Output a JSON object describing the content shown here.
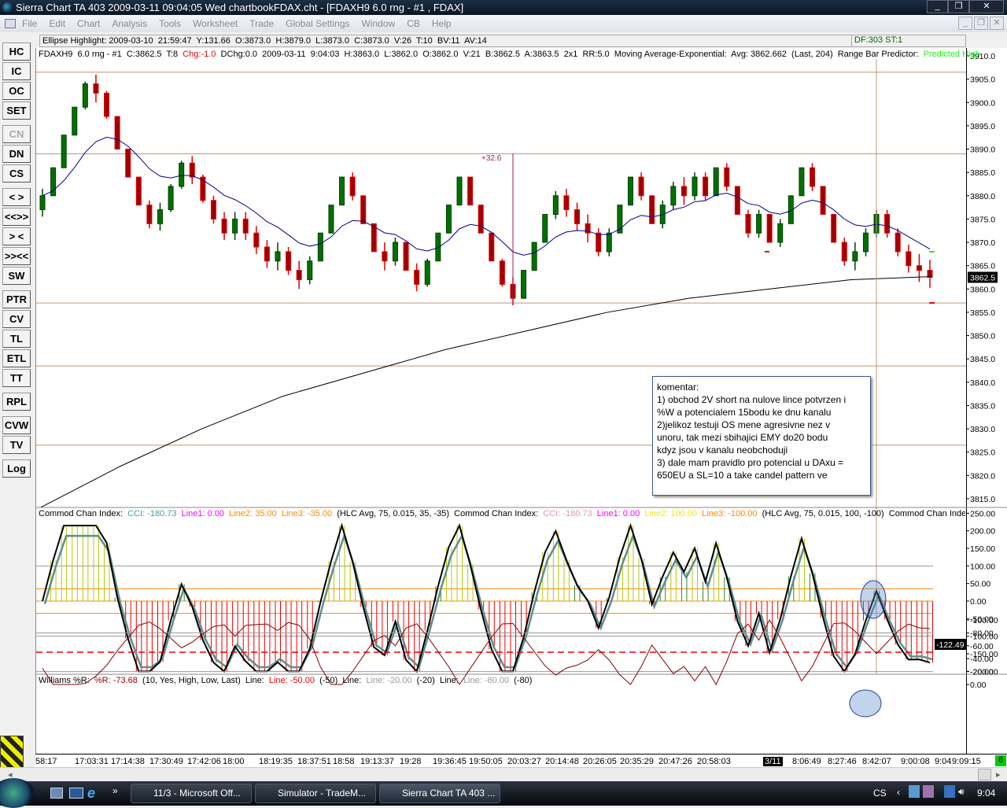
{
  "window": {
    "title": "Sierra Chart TA 403  2009-03-11  09:04:05  Wed   chartbookFDAX.cht - [FDAXH9  6.0 rng - #1 , FDAX]"
  },
  "menu": [
    "File",
    "Edit",
    "Chart",
    "Analysis",
    "Tools",
    "Worksheet",
    "Trade",
    "Global Settings",
    "Window",
    "CB",
    "Help"
  ],
  "toolbar": [
    {
      "l": "HC"
    },
    {
      "l": "IC"
    },
    {
      "l": "OC"
    },
    {
      "l": "SET"
    },
    {
      "l": "CN",
      "disabled": true
    },
    {
      "l": "DN"
    },
    {
      "l": "CS"
    },
    {
      "l": "< >"
    },
    {
      "l": "<<>>"
    },
    {
      "l": "> <"
    },
    {
      "l": ">><<"
    },
    {
      "l": "SW"
    },
    {
      "l": "PTR"
    },
    {
      "l": "CV"
    },
    {
      "l": "TL"
    },
    {
      "l": "ETL"
    },
    {
      "l": "TT"
    },
    {
      "l": "RPL"
    },
    {
      "l": "CVW"
    },
    {
      "l": "TV"
    },
    {
      "l": "Log"
    }
  ],
  "info": {
    "ellipse": "Ellipse Highlight: 2009-03-10  21:59:47  Y:131.66  O:3873.0  H:3879.0  L:3873.0  C:3873.0  V:26  T:10  BV:11  AV:14",
    "df": "DF:303  ST:1"
  },
  "price_header": {
    "main": "FDAXH9  6.0 rng - #1  C:3862.5  T:8  ",
    "chg": "Chg:-1.0",
    "rest": "  DChg:0.0  2009-03-11  9:04:03  H:3863.0  L:3862.0  O:3862.0  V:21  B:3862.5  A:3863.5  2x1  RR:5.0  Moving Average-Exponential:  Avg: 3862.662  (Last, 204)  Range Bar Predictor:  ",
    "pred": "Predicted High"
  },
  "cci_header": {
    "a": "Commod Chan Index:  ",
    "b": "CCI: -180.73  ",
    "c": "Line1: 0.00  ",
    "d": "Line2: 35.00  ",
    "e": "Line3: -35.00  ",
    "f": "(HLC Avg, 75, 0.015, 35, -35)  Commod Chan Index:  ",
    "g": "CCI: -180.73  ",
    "h": "Line1: 0.00  ",
    "i": "Line2: 100.00  ",
    "j": "Line3: -100.00  ",
    "k": "(HLC Avg, 75, 0.015, 100, -100)  Commod Chan Index:  ",
    "l": "CC"
  },
  "wr_header": {
    "a": "Williams %R:  ",
    "b": "%R: -73.68",
    "c": "  (10, Yes, High, Low, Last)  Line:  ",
    "d": "Line: -50.00",
    "e": "  (-50)  Line:  ",
    "f": "Line: -20.00",
    "g": "  (-20)  Line:  ",
    "h": "Line: -80.00",
    "i": "  (-80)"
  },
  "annotation": {
    "label": "+32.6"
  },
  "comment": [
    "komentar:",
    "1) obchod 2V short na nulove lince potvrzen i",
    "%W a potencialem 15bodu ke dnu kanalu",
    "2)jelikoz testuji OS mene agresivne nez v",
    "unoru, tak mezi sbihajici EMY do20 bodu",
    "kdyz jsou v kanalu neobchoduji",
    "3) dale mam pravidlo pro potencial u DAxu =",
    "650EU a SL=10 a take candel pattern ve"
  ],
  "time_labels": [
    "58:17",
    "17:03:31",
    "17:14:38",
    "17:30:49",
    "17:42:06",
    "18:00",
    "18:19:35",
    "18:37:51",
    "18:58",
    "19:13:37",
    "19:28",
    "19:36:45",
    "19:50:05",
    "20:03:27",
    "20:14:48",
    "20:26:05",
    "20:35:29",
    "20:47:26",
    "20:58:03",
    "3/11",
    "8:06:49",
    "8:27:46",
    "8:42:07",
    "9:00:08",
    "9:04",
    "9:09:15"
  ],
  "badge": "6",
  "taskbar": {
    "items": [
      "11/3 - Microsoft Off...",
      "Simulator - TradeM...",
      "Sierra Chart TA 403  ..."
    ],
    "lang": "CS",
    "clock": "9:04"
  },
  "colors": {
    "up": "#007000",
    "down": "#e00000",
    "ema": "#00008b",
    "long_ma": "#000000",
    "hline": "#c8956a"
  },
  "chart_data": [
    {
      "type": "candlestick",
      "title": "FDAXH9 6.0 rng",
      "range": 6.0,
      "closes": [
        3880,
        3886,
        3893,
        3899,
        3904,
        3902,
        3897,
        3890,
        3884,
        3878,
        3874,
        3877,
        3882,
        3887,
        3884,
        3879,
        3875,
        3872,
        3875,
        3872,
        3869,
        3866,
        3868,
        3864,
        3862,
        3866,
        3872,
        3878,
        3884,
        3880,
        3874,
        3868,
        3866,
        3870,
        3864,
        3861,
        3866,
        3872,
        3878,
        3884,
        3878,
        3872,
        3866,
        3861,
        3858,
        3864,
        3870,
        3876,
        3880,
        3877,
        3874,
        3872,
        3868,
        3872,
        3878,
        3884,
        3880,
        3874,
        3878,
        3882,
        3880,
        3884,
        3880,
        3886,
        3882,
        3876,
        3872,
        3876,
        3870,
        3874,
        3880,
        3886,
        3882,
        3876,
        3870,
        3866,
        3868,
        3872,
        3876,
        3872,
        3868,
        3865,
        3864,
        3862.5
      ],
      "long_ma": [
        3813,
        3822,
        3830,
        3837,
        3842,
        3847,
        3851,
        3855,
        3858,
        3860,
        3862,
        3862.66
      ],
      "hlines": [
        3906.5,
        3889,
        3857,
        3843.5,
        3826.5
      ],
      "last": "3862.5",
      "ylim": [
        3813,
        3911
      ],
      "yticks": [
        "3910.0",
        "3905.0",
        "3900.0",
        "3895.0",
        "3890.0",
        "3885.0",
        "3880.0",
        "3875.0",
        "3870.0",
        "3865.0",
        "3860.0",
        "3855.0",
        "3850.0",
        "3845.0",
        "3840.0",
        "3835.0",
        "3830.0",
        "3825.0",
        "3820.0",
        "3815.0"
      ]
    },
    {
      "type": "line",
      "title": "Commod Chan Index",
      "ylim": [
        -210,
        260
      ],
      "levels": [
        100,
        35,
        0,
        -35,
        -100
      ],
      "last": "-122.49",
      "yticks": [
        "250.00",
        "200.00",
        "150.00",
        "100.00",
        "50.00",
        "0.00",
        "-50.00",
        "-100.00",
        "-150.00",
        "-200.00"
      ]
    },
    {
      "type": "line",
      "title": "Williams %R",
      "ylim": [
        -100,
        0
      ],
      "levels": [
        -20,
        -50,
        -80
      ],
      "yticks": [
        "0.00",
        "-20.00",
        "-40.00",
        "-60.00",
        "-80.00",
        "-100.00"
      ]
    }
  ]
}
